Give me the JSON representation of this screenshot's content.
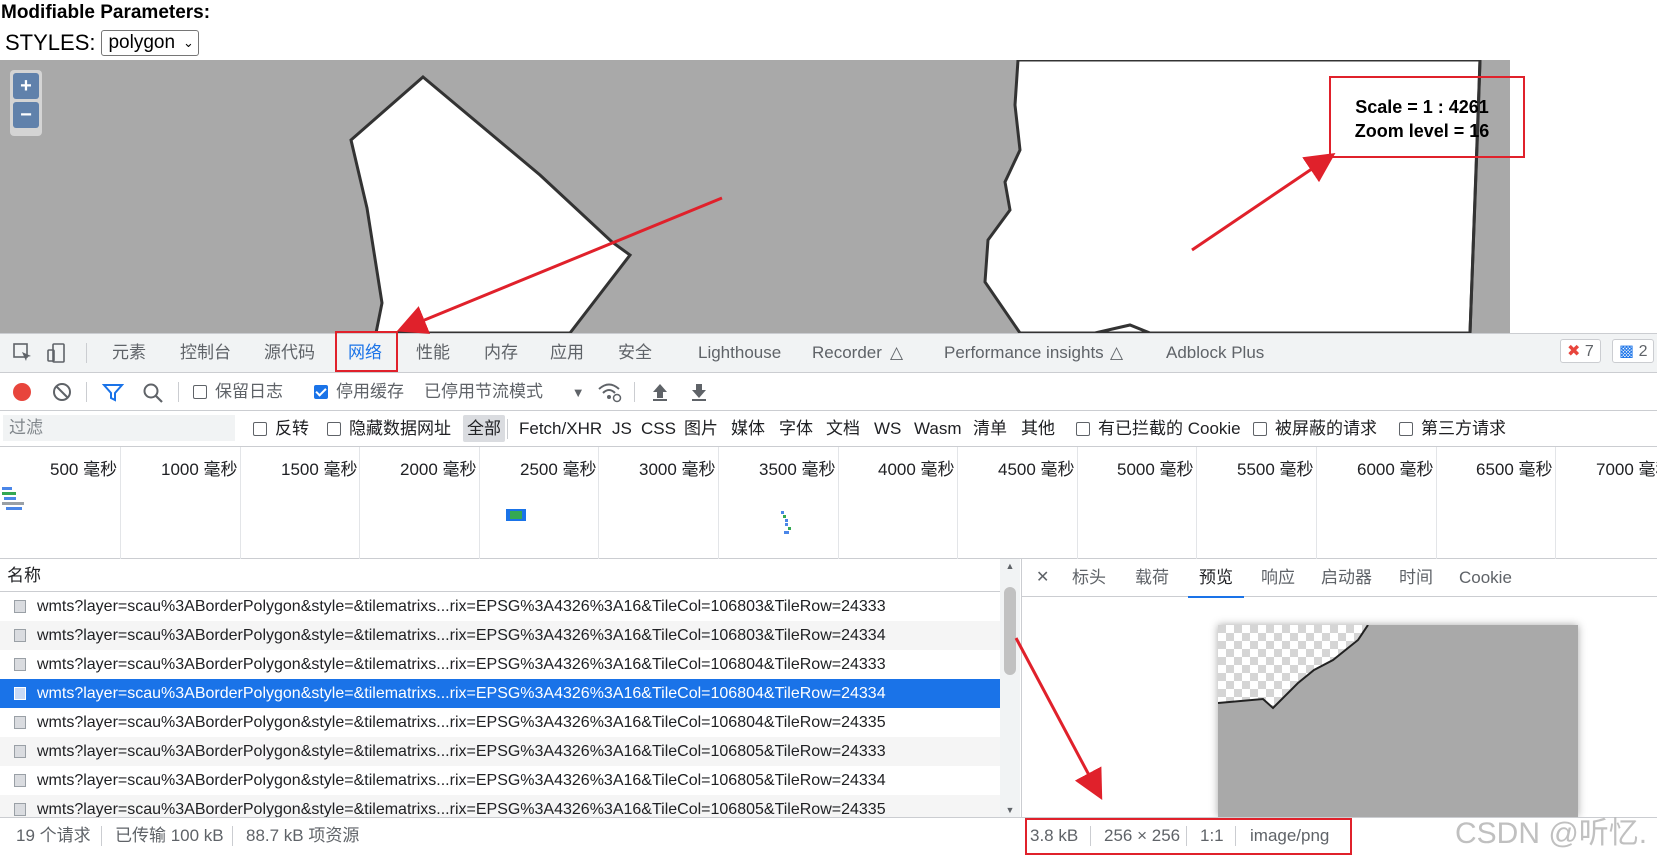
{
  "page": {
    "title": "Modifiable Parameters:",
    "styles_label": "STYLES:",
    "styles_value": "polygon",
    "zoom_in": "+",
    "zoom_out": "−",
    "scale_line": "Scale = 1 : 4261",
    "zoom_line": "Zoom level = 16"
  },
  "devtools": {
    "tabs": [
      "元素",
      "控制台",
      "源代码",
      "网络",
      "性能",
      "内存",
      "应用",
      "安全",
      "Lighthouse",
      "Recorder",
      "Performance insights",
      "Adblock Plus"
    ],
    "errors_count": "7",
    "messages_count": "2",
    "toolbar": {
      "preserve_log": "保留日志",
      "disable_cache": "停用缓存",
      "throttling": "已停用节流模式"
    },
    "filter": {
      "placeholder": "过滤",
      "invert": "反转",
      "hide_data_urls": "隐藏数据网址",
      "types": [
        "全部",
        "Fetch/XHR",
        "JS",
        "CSS",
        "图片",
        "媒体",
        "字体",
        "文档",
        "WS",
        "Wasm",
        "清单",
        "其他"
      ],
      "blocked_cookies": "有已拦截的 Cookie",
      "blocked_requests": "被屏蔽的请求",
      "third_party": "第三方请求"
    },
    "timeline_ticks": [
      "500 毫秒",
      "1000 毫秒",
      "1500 毫秒",
      "2000 毫秒",
      "2500 毫秒",
      "3000 毫秒",
      "3500 毫秒",
      "4000 毫秒",
      "4500 毫秒",
      "5000 毫秒",
      "5500 毫秒",
      "6000 毫秒",
      "6500 毫秒",
      "7000 毫秒"
    ],
    "list_header": "名称",
    "requests": [
      "wmts?layer=scau%3ABorderPolygon&style=&tilematrixs...rix=EPSG%3A4326%3A16&TileCol=106803&TileRow=24333",
      "wmts?layer=scau%3ABorderPolygon&style=&tilematrixs...rix=EPSG%3A4326%3A16&TileCol=106803&TileRow=24334",
      "wmts?layer=scau%3ABorderPolygon&style=&tilematrixs...rix=EPSG%3A4326%3A16&TileCol=106804&TileRow=24333",
      "wmts?layer=scau%3ABorderPolygon&style=&tilematrixs...rix=EPSG%3A4326%3A16&TileCol=106804&TileRow=24334",
      "wmts?layer=scau%3ABorderPolygon&style=&tilematrixs...rix=EPSG%3A4326%3A16&TileCol=106804&TileRow=24335",
      "wmts?layer=scau%3ABorderPolygon&style=&tilematrixs...rix=EPSG%3A4326%3A16&TileCol=106805&TileRow=24333",
      "wmts?layer=scau%3ABorderPolygon&style=&tilematrixs...rix=EPSG%3A4326%3A16&TileCol=106805&TileRow=24334",
      "wmts?layer=scau%3ABorderPolygon&style=&tilematrixs...rix=EPSG%3A4326%3A16&TileCol=106805&TileRow=24335"
    ],
    "selected_request_index": 3,
    "preview_tabs": [
      "标头",
      "载荷",
      "预览",
      "响应",
      "启动器",
      "时间",
      "Cookie"
    ],
    "preview_active": "预览",
    "status": {
      "requests": "19 个请求",
      "transferred": "已传输 100 kB",
      "resources": "88.7 kB 项资源"
    },
    "preview_status": {
      "size": "3.8 kB",
      "dimensions": "256 × 256",
      "ratio": "1:1",
      "mime": "image/png"
    }
  },
  "watermark": "CSDN @听忆.",
  "colors": {
    "accent": "#1a73e8",
    "annotation_red": "#e0212b",
    "map_gray": "#a9a9a9",
    "record_red": "#e8453c"
  }
}
